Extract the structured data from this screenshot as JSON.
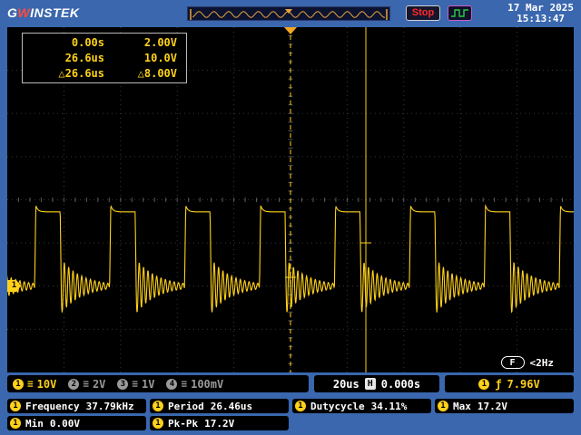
{
  "header": {
    "logo": {
      "g": "G",
      "w": "W",
      "rest": "INSTEK"
    },
    "stop_label": "Stop",
    "date": "17 Mar 2025",
    "time": "15:13:47"
  },
  "cursor_readout": {
    "rows": [
      {
        "t": "0.00s",
        "v": "2.00V"
      },
      {
        "t": "26.6us",
        "v": "10.0V"
      },
      {
        "t": "△26.6us",
        "v": "△8.00V"
      }
    ]
  },
  "trigger_indicator": {
    "badge": "F",
    "freq": "<2Hz"
  },
  "channels": [
    {
      "num": "1",
      "coupling": "≡",
      "scale": "10V",
      "active": true
    },
    {
      "num": "2",
      "coupling": "≡",
      "scale": "2V",
      "active": false
    },
    {
      "num": "3",
      "coupling": "≡",
      "scale": "1V",
      "active": false
    },
    {
      "num": "4",
      "coupling": "≡",
      "scale": "100mV",
      "active": false
    }
  ],
  "timebase": {
    "scale": "20us",
    "h_label": "H",
    "offset": "0.000s"
  },
  "trigger_info": {
    "ch": "1",
    "edge": "ƒ",
    "level": "7.96V"
  },
  "measurements": {
    "row1": [
      {
        "ch": "1",
        "label": "Frequency",
        "value": "37.79kHz"
      },
      {
        "ch": "1",
        "label": "Period",
        "value": "26.46us"
      },
      {
        "ch": "1",
        "label": "Dutycycle",
        "value": "34.11%"
      },
      {
        "ch": "1",
        "label": "Max",
        "value": "17.2V"
      }
    ],
    "row2": [
      {
        "ch": "1",
        "label": "Min",
        "value": "0.00V"
      },
      {
        "ch": "1",
        "label": "Pk-Pk",
        "value": "17.2V"
      }
    ]
  },
  "waveform": {
    "channel": 1,
    "period_us": 26.46,
    "duty": 0.3411,
    "max_v": 17.2,
    "min_v": 0.0,
    "us_per_div": 20,
    "volts_per_div": 10,
    "baseline_div_below_center": 2
  },
  "colors": {
    "frame_blue": "#3a67ae",
    "trace_yellow": "#ffd11a",
    "stop_red": "#ff2a2a",
    "trigger_green": "#2ecc40",
    "text_white": "#ffffff",
    "inactive_gray": "#9a9a9a",
    "preview_orange": "#e8a33d"
  }
}
